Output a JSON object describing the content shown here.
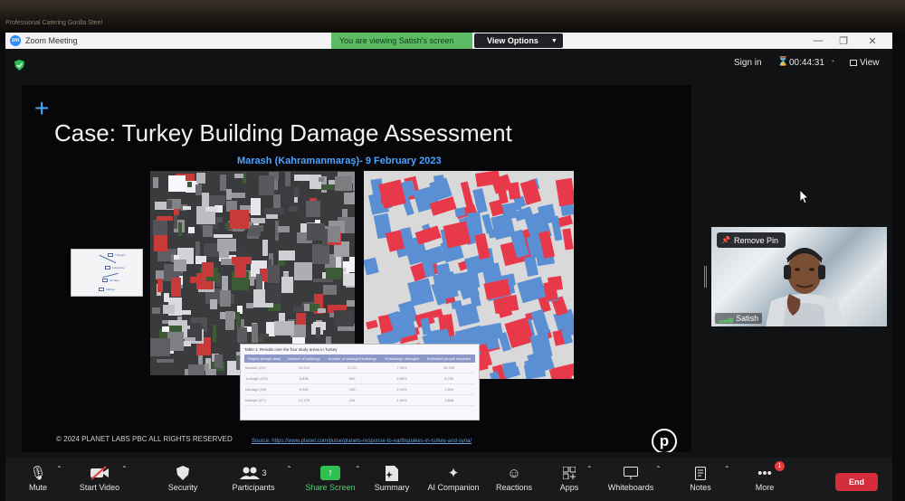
{
  "bezel": {
    "text": "Professional Catering Gorilla Steel"
  },
  "window": {
    "app_title": "Zoom Meeting",
    "viewing_banner": "You are viewing Satish's screen",
    "view_options_label": "View Options",
    "minimize": "—",
    "restore": "❐",
    "close": "✕"
  },
  "header": {
    "sign_in": "Sign in",
    "timer": "00:44:31",
    "view_label": "View"
  },
  "slide": {
    "plus": "+",
    "title": "Case: Turkey Building Damage Assessment",
    "subtitle": "Marash (Kahramanmaraş)- 9 February 2023",
    "copyright": "© 2024 PLANET LABS PBC ALL RIGHTS RESERVED",
    "source": "Source: https://www.planet.com/pulse/planets-response-to-earthquakes-in-turkey-and-syria/",
    "logo_letter": "p",
    "table": {
      "caption": "Table 1: Results over the four study areas in Turkey",
      "headers": [
        "Region (Image date)",
        "Number of buildings",
        "Number of damaged buildings",
        "% buildings damaged",
        "Estimated people impacted"
      ],
      "rows": [
        [
          "Marash (2/9)",
          "43,510",
          "3,221",
          "7.40%",
          "96,330"
        ],
        [
          "Turkoglu (2/9)",
          "8,836",
          "505",
          "5.80%",
          "5,252"
        ],
        [
          "Nurdagi (2/9)",
          "6,361",
          "133",
          "2.10%",
          "1,504"
        ],
        [
          "Islahiye (2/7)",
          "12,176",
          "234",
          "1.90%",
          "1,868"
        ]
      ]
    },
    "thumb_labels": [
      "Turkoglu",
      "Gaziantep",
      "Nurdagi",
      "Islahiye"
    ]
  },
  "participant": {
    "name": "Satish",
    "remove_pin": "Remove Pin"
  },
  "toolbar": {
    "mute": "Mute",
    "start_video": "Start Video",
    "security": "Security",
    "participants": "Participants",
    "participants_count": "3",
    "share_screen": "Share Screen",
    "summary": "Summary",
    "ai_companion": "AI Companion",
    "reactions": "Reactions",
    "apps": "Apps",
    "whiteboards": "Whiteboards",
    "notes": "Notes",
    "more": "More",
    "more_badge": "1",
    "end": "End"
  },
  "colors": {
    "accent": "#2d8cff",
    "banner_green": "#5dbb63",
    "end_red": "#d32d3a",
    "damage_red": "#e8394a",
    "building_blue": "#5b8fd4"
  }
}
